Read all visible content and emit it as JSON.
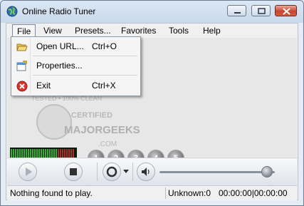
{
  "window": {
    "title": "Online Radio Tuner",
    "icon": "globe-icon",
    "controls": [
      "minimize-icon",
      "maximize-icon",
      "close-icon"
    ]
  },
  "menubar": {
    "items": [
      {
        "label": "File"
      },
      {
        "label": "View"
      },
      {
        "label": "Presets..."
      },
      {
        "label": "Favorites"
      },
      {
        "label": "Tools"
      },
      {
        "label": "Help"
      }
    ],
    "active": "File"
  },
  "file_menu": {
    "items": [
      {
        "icon": "open-folder-icon",
        "label": "Open URL...",
        "shortcut": "Ctrl+O"
      },
      {
        "icon": "properties-icon",
        "label": "Properties...",
        "shortcut": ""
      },
      {
        "icon": "exit-icon",
        "label": "Exit",
        "shortcut": "Ctrl+X"
      }
    ]
  },
  "watermark": {
    "lines": [
      "TESTED • 100% CLEAN",
      "CERTIFIED",
      "MAJORGEEKS",
      ".COM"
    ]
  },
  "presets": [
    "1",
    "2",
    "3",
    "4",
    "5"
  ],
  "controls": {
    "play_icon": "play-icon",
    "stop_icon": "stop-icon",
    "record_icon": "record-icon",
    "dropdown_icon": "chevron-down-icon",
    "volume_icon": "speaker-icon",
    "volume_level": 0.93
  },
  "status": {
    "message": "Nothing found to play.",
    "stream": "Unknown:0",
    "time": "00:00:00|00:00:00"
  },
  "colors": {
    "vu_green": "#3bbf3b",
    "vu_red": "#c0392b",
    "close_red": "#c8452f"
  }
}
